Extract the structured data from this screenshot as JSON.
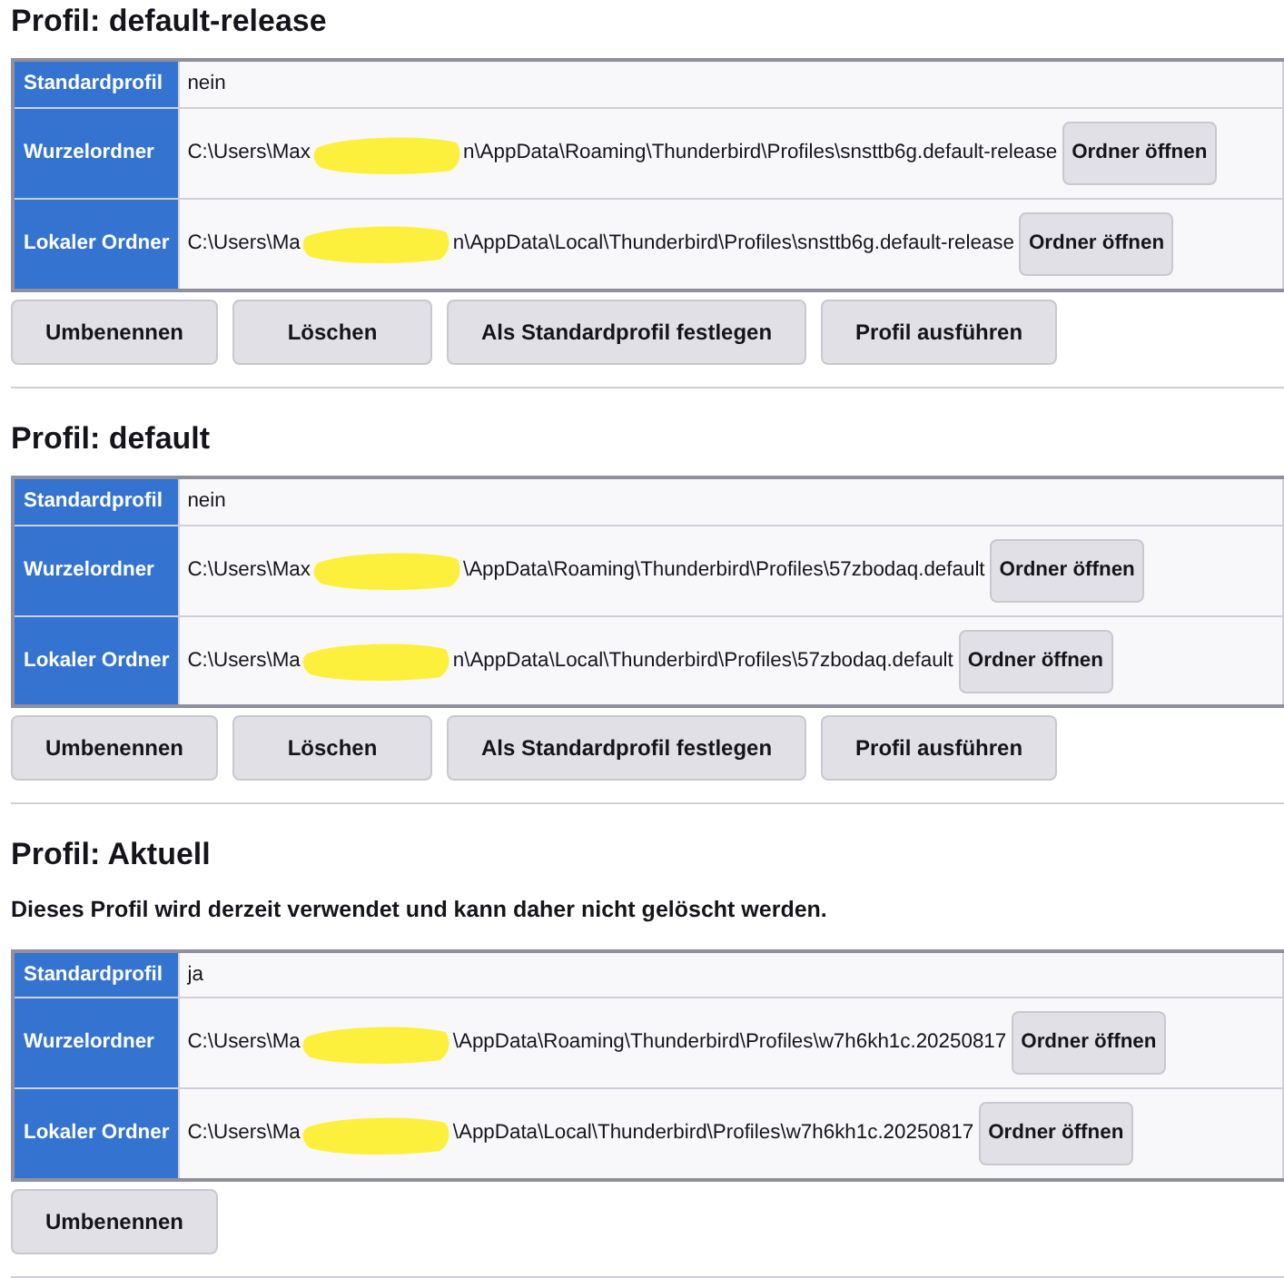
{
  "profiles": [
    {
      "title": "Profil: default-release",
      "rows": [
        {
          "kind": "text",
          "label": "Standardprofil",
          "value": "nein"
        },
        {
          "kind": "path",
          "label": "Wurzelordner",
          "path_start": "C:\\Users\\Max",
          "path_end": "n\\AppData\\Roaming\\Thunderbird\\Profiles\\snsttb6g.default-release",
          "button": "Ordner öffnen"
        },
        {
          "kind": "path",
          "label": "Lokaler Ordner",
          "path_start": "C:\\Users\\Ma",
          "path_end": "n\\AppData\\Local\\Thunderbird\\Profiles\\snsttb6g.default-release",
          "button": "Ordner öffnen"
        }
      ],
      "actions": [
        "Umbenennen",
        "Löschen",
        "Als Standardprofil festlegen",
        "Profil ausführen"
      ]
    },
    {
      "title": "Profil: default",
      "rows": [
        {
          "kind": "text",
          "label": "Standardprofil",
          "value": "nein"
        },
        {
          "kind": "path",
          "label": "Wurzelordner",
          "path_start": "C:\\Users\\Max",
          "path_end": "\\AppData\\Roaming\\Thunderbird\\Profiles\\57zbodaq.default",
          "button": "Ordner öffnen"
        },
        {
          "kind": "path",
          "label": "Lokaler Ordner",
          "path_start": "C:\\Users\\Ma",
          "path_end": "n\\AppData\\Local\\Thunderbird\\Profiles\\57zbodaq.default",
          "button": "Ordner öffnen"
        }
      ],
      "actions": [
        "Umbenennen",
        "Löschen",
        "Als Standardprofil festlegen",
        "Profil ausführen"
      ]
    },
    {
      "title": "Profil: Aktuell",
      "note": "Dieses Profil wird derzeit verwendet und kann daher nicht gelöscht werden.",
      "rows": [
        {
          "kind": "text",
          "label": "Standardprofil",
          "value": "ja"
        },
        {
          "kind": "path",
          "label": "Wurzelordner",
          "path_start": "C:\\Users\\Ma",
          "path_end": "\\AppData\\Roaming\\Thunderbird\\Profiles\\w7h6kh1c.20250817",
          "button": "Ordner öffnen"
        },
        {
          "kind": "path",
          "label": "Lokaler Ordner",
          "path_start": "C:\\Users\\Ma",
          "path_end": "\\AppData\\Local\\Thunderbird\\Profiles\\w7h6kh1c.20250817",
          "button": "Ordner öffnen"
        }
      ],
      "actions": [
        "Umbenennen"
      ]
    }
  ]
}
